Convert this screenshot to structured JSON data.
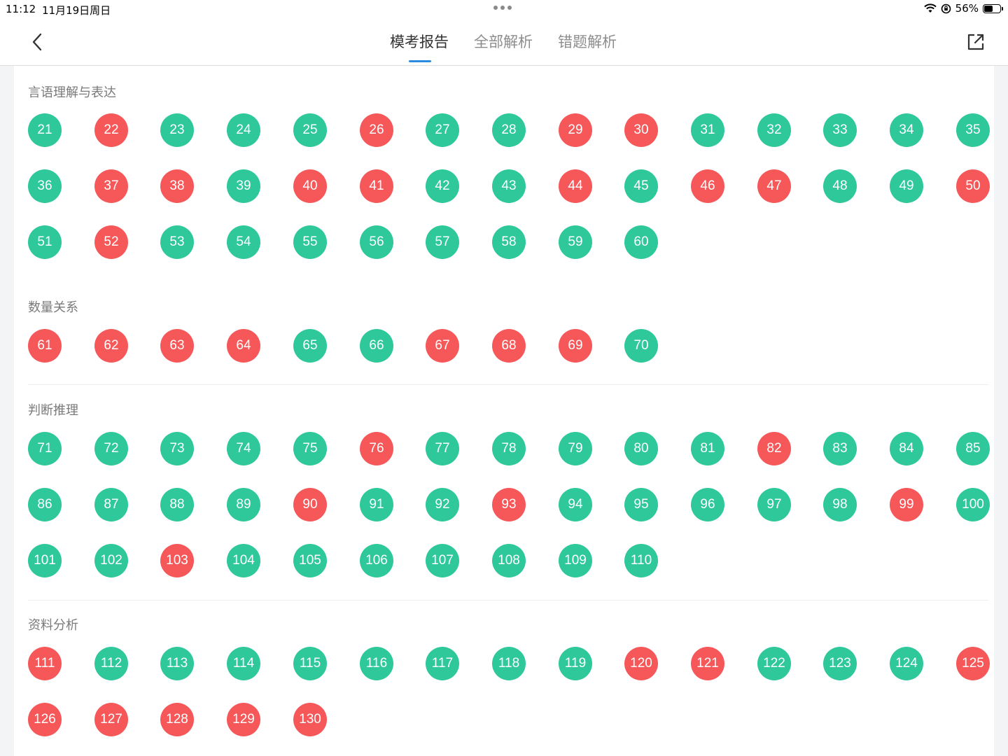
{
  "status_bar": {
    "time": "11:12",
    "date": "11月19日周日",
    "battery": "56%",
    "battery_level": 0.56
  },
  "nav": {
    "tabs": [
      {
        "label": "模考报告",
        "active": true
      },
      {
        "label": "全部解析",
        "active": false
      },
      {
        "label": "错题解析",
        "active": false
      }
    ]
  },
  "colors": {
    "correct": "#2ec89a",
    "wrong": "#f6585a",
    "tab_underline": "#2a8be0"
  },
  "sections": [
    {
      "title": "言语理解与表达",
      "questions": [
        {
          "n": "21",
          "s": "c"
        },
        {
          "n": "22",
          "s": "w"
        },
        {
          "n": "23",
          "s": "c"
        },
        {
          "n": "24",
          "s": "c"
        },
        {
          "n": "25",
          "s": "c"
        },
        {
          "n": "26",
          "s": "w"
        },
        {
          "n": "27",
          "s": "c"
        },
        {
          "n": "28",
          "s": "c"
        },
        {
          "n": "29",
          "s": "w"
        },
        {
          "n": "30",
          "s": "w"
        },
        {
          "n": "31",
          "s": "c"
        },
        {
          "n": "32",
          "s": "c"
        },
        {
          "n": "33",
          "s": "c"
        },
        {
          "n": "34",
          "s": "c"
        },
        {
          "n": "35",
          "s": "c"
        },
        {
          "n": "36",
          "s": "c"
        },
        {
          "n": "37",
          "s": "w"
        },
        {
          "n": "38",
          "s": "w"
        },
        {
          "n": "39",
          "s": "c"
        },
        {
          "n": "40",
          "s": "w"
        },
        {
          "n": "41",
          "s": "w"
        },
        {
          "n": "42",
          "s": "c"
        },
        {
          "n": "43",
          "s": "c"
        },
        {
          "n": "44",
          "s": "w"
        },
        {
          "n": "45",
          "s": "c"
        },
        {
          "n": "46",
          "s": "w"
        },
        {
          "n": "47",
          "s": "w"
        },
        {
          "n": "48",
          "s": "c"
        },
        {
          "n": "49",
          "s": "c"
        },
        {
          "n": "50",
          "s": "w"
        },
        {
          "n": "51",
          "s": "c"
        },
        {
          "n": "52",
          "s": "w"
        },
        {
          "n": "53",
          "s": "c"
        },
        {
          "n": "54",
          "s": "c"
        },
        {
          "n": "55",
          "s": "c"
        },
        {
          "n": "56",
          "s": "c"
        },
        {
          "n": "57",
          "s": "c"
        },
        {
          "n": "58",
          "s": "c"
        },
        {
          "n": "59",
          "s": "c"
        },
        {
          "n": "60",
          "s": "c"
        }
      ]
    },
    {
      "title": "数量关系",
      "questions": [
        {
          "n": "61",
          "s": "w"
        },
        {
          "n": "62",
          "s": "w"
        },
        {
          "n": "63",
          "s": "w"
        },
        {
          "n": "64",
          "s": "w"
        },
        {
          "n": "65",
          "s": "c"
        },
        {
          "n": "66",
          "s": "c"
        },
        {
          "n": "67",
          "s": "w"
        },
        {
          "n": "68",
          "s": "w"
        },
        {
          "n": "69",
          "s": "w"
        },
        {
          "n": "70",
          "s": "c"
        }
      ]
    },
    {
      "title": "判断推理",
      "questions": [
        {
          "n": "71",
          "s": "c"
        },
        {
          "n": "72",
          "s": "c"
        },
        {
          "n": "73",
          "s": "c"
        },
        {
          "n": "74",
          "s": "c"
        },
        {
          "n": "75",
          "s": "c"
        },
        {
          "n": "76",
          "s": "w"
        },
        {
          "n": "77",
          "s": "c"
        },
        {
          "n": "78",
          "s": "c"
        },
        {
          "n": "79",
          "s": "c"
        },
        {
          "n": "80",
          "s": "c"
        },
        {
          "n": "81",
          "s": "c"
        },
        {
          "n": "82",
          "s": "w"
        },
        {
          "n": "83",
          "s": "c"
        },
        {
          "n": "84",
          "s": "c"
        },
        {
          "n": "85",
          "s": "c"
        },
        {
          "n": "86",
          "s": "c"
        },
        {
          "n": "87",
          "s": "c"
        },
        {
          "n": "88",
          "s": "c"
        },
        {
          "n": "89",
          "s": "c"
        },
        {
          "n": "90",
          "s": "w"
        },
        {
          "n": "91",
          "s": "c"
        },
        {
          "n": "92",
          "s": "c"
        },
        {
          "n": "93",
          "s": "w"
        },
        {
          "n": "94",
          "s": "c"
        },
        {
          "n": "95",
          "s": "c"
        },
        {
          "n": "96",
          "s": "c"
        },
        {
          "n": "97",
          "s": "c"
        },
        {
          "n": "98",
          "s": "c"
        },
        {
          "n": "99",
          "s": "w"
        },
        {
          "n": "100",
          "s": "c"
        },
        {
          "n": "101",
          "s": "c"
        },
        {
          "n": "102",
          "s": "c"
        },
        {
          "n": "103",
          "s": "w"
        },
        {
          "n": "104",
          "s": "c"
        },
        {
          "n": "105",
          "s": "c"
        },
        {
          "n": "106",
          "s": "c"
        },
        {
          "n": "107",
          "s": "c"
        },
        {
          "n": "108",
          "s": "c"
        },
        {
          "n": "109",
          "s": "c"
        },
        {
          "n": "110",
          "s": "c"
        }
      ]
    },
    {
      "title": "资料分析",
      "questions": [
        {
          "n": "111",
          "s": "w"
        },
        {
          "n": "112",
          "s": "c"
        },
        {
          "n": "113",
          "s": "c"
        },
        {
          "n": "114",
          "s": "c"
        },
        {
          "n": "115",
          "s": "c"
        },
        {
          "n": "116",
          "s": "c"
        },
        {
          "n": "117",
          "s": "c"
        },
        {
          "n": "118",
          "s": "c"
        },
        {
          "n": "119",
          "s": "c"
        },
        {
          "n": "120",
          "s": "w"
        },
        {
          "n": "121",
          "s": "w"
        },
        {
          "n": "122",
          "s": "c"
        },
        {
          "n": "123",
          "s": "c"
        },
        {
          "n": "124",
          "s": "c"
        },
        {
          "n": "125",
          "s": "w"
        },
        {
          "n": "126",
          "s": "w"
        },
        {
          "n": "127",
          "s": "w"
        },
        {
          "n": "128",
          "s": "w"
        },
        {
          "n": "129",
          "s": "w"
        },
        {
          "n": "130",
          "s": "w"
        }
      ]
    }
  ]
}
